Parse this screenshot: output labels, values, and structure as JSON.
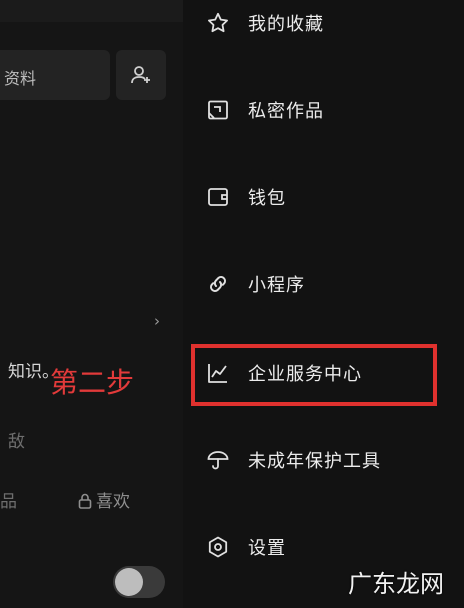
{
  "profile_bg": {
    "edit_profile_fragment": "资料",
    "bio_line1": "知识。",
    "bio_line2": "敌",
    "tab_fragment": "品",
    "likes_label": "喜欢",
    "chevron": "›"
  },
  "annotation": {
    "step_label": "第二步"
  },
  "drawer": {
    "items": [
      {
        "label": "我的收藏",
        "icon": "star-icon"
      },
      {
        "label": "私密作品",
        "icon": "private-works-icon"
      },
      {
        "label": "钱包",
        "icon": "wallet-icon"
      },
      {
        "label": "小程序",
        "icon": "mini-program-link-icon"
      },
      {
        "label": "企业服务中心",
        "icon": "chart-line-icon"
      },
      {
        "label": "未成年保护工具",
        "icon": "umbrella-icon"
      },
      {
        "label": "设置",
        "icon": "settings-hexagon-icon"
      }
    ]
  },
  "watermark": "广东龙网",
  "colors": {
    "background": "#121212",
    "highlight": "#e0312e",
    "annotation_text": "#e23a3a"
  }
}
